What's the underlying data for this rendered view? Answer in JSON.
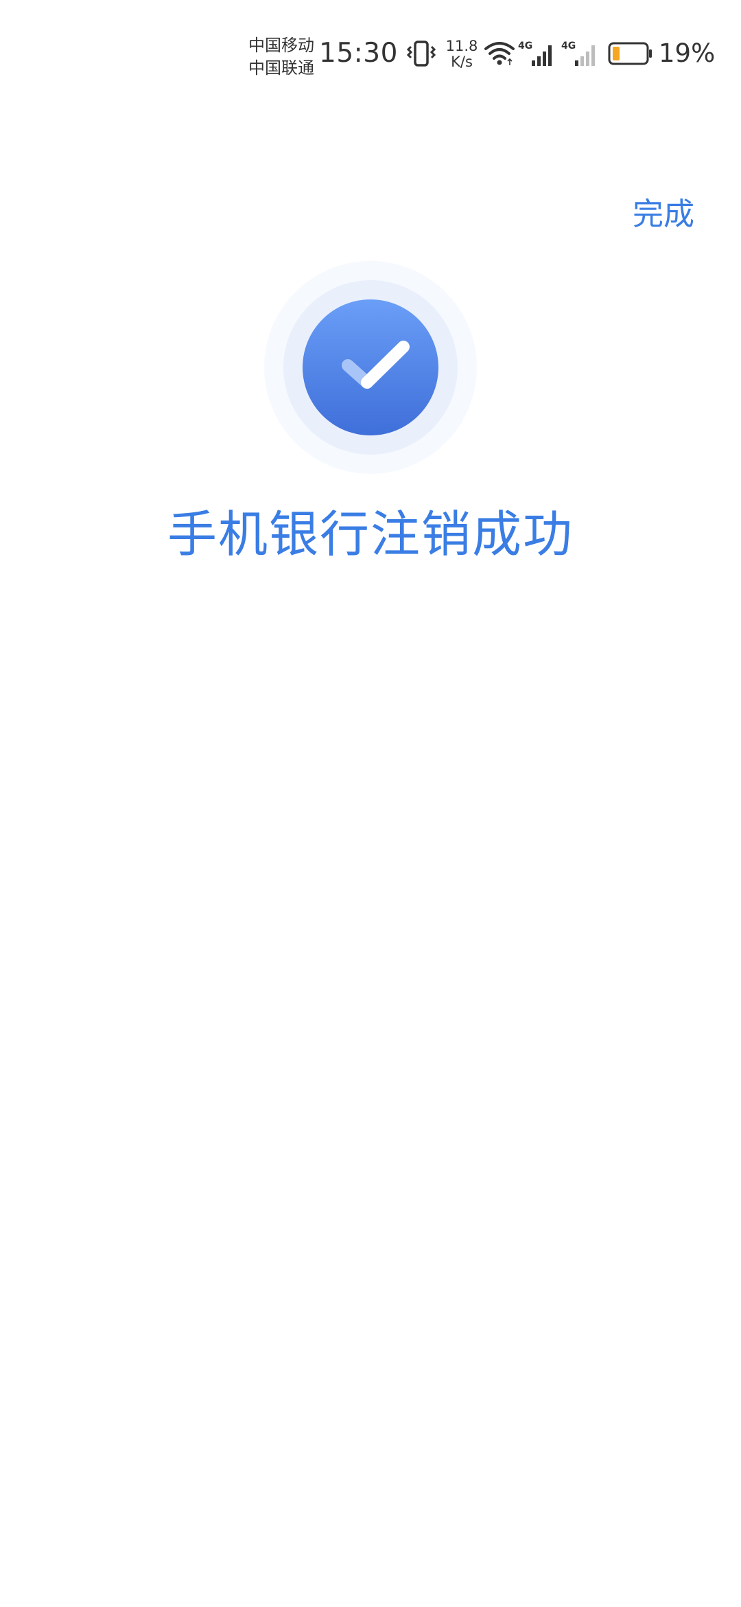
{
  "status_bar": {
    "carrier_1": "中国移动",
    "carrier_2": "中国联通",
    "time": "15:30",
    "net_speed_value": "11.8",
    "net_speed_unit": "K/s",
    "signal_1_label": "4G",
    "signal_2_label": "4G",
    "battery_percent": "19%",
    "battery_level": 0.19,
    "battery_color": "#f5a623"
  },
  "header": {
    "done_label": "完成"
  },
  "result": {
    "title": "手机银行注销成功",
    "icon": "check-circle-icon"
  },
  "colors": {
    "accent": "#3a7de4",
    "icon_gradient_top": "#6a9ef7",
    "icon_gradient_bottom": "#3f6fd9",
    "halo_inner": "#e9f0fc",
    "halo_outer": "#f6f9fe"
  }
}
